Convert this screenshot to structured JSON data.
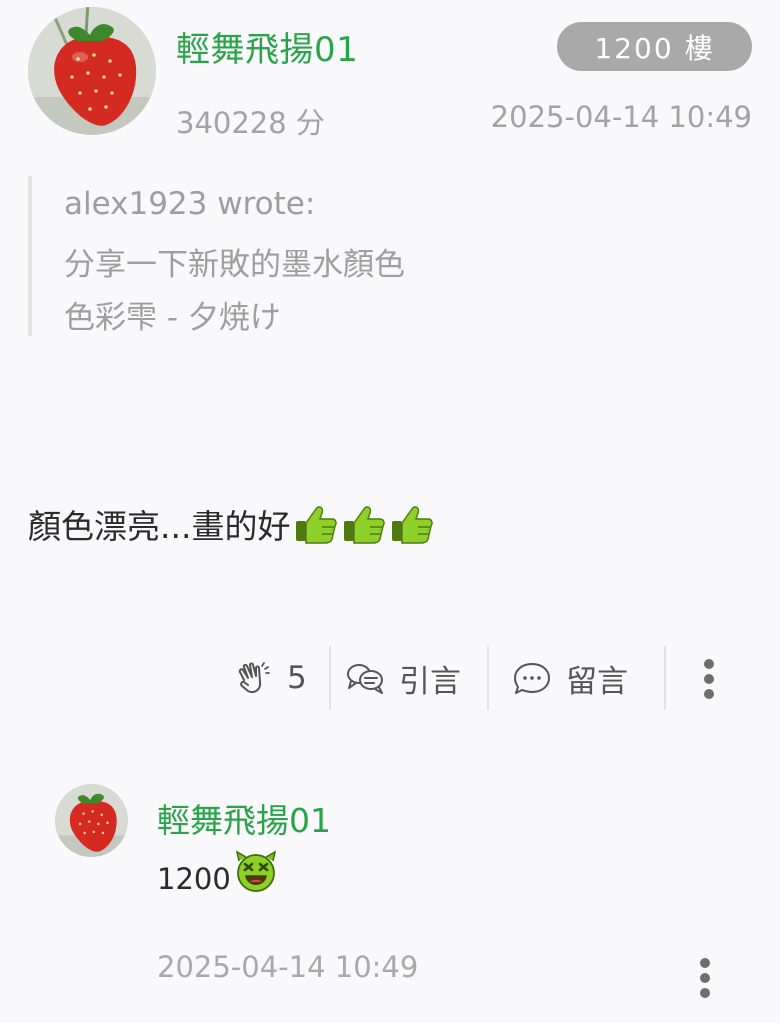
{
  "post": {
    "author": "輕舞飛揚01",
    "floor": "1200 樓",
    "score": "340228 分",
    "timestamp": "2025-04-14 10:49",
    "quote": {
      "header": "alex1923 wrote:",
      "lines": [
        "分享一下新敗的墨水顏色",
        "色彩雫 - 夕焼け"
      ]
    },
    "body": "顏色漂亮...畫的好",
    "body_emoji": [
      "thumbs-up-icon",
      "thumbs-up-icon",
      "thumbs-up-icon"
    ],
    "actions": {
      "likes_count": "5",
      "quote_label": "引言",
      "comment_label": "留言"
    }
  },
  "comment": {
    "author": "輕舞飛揚01",
    "text": "1200",
    "emoji": "laughing-face-icon",
    "timestamp": "2025-04-14 10:49"
  },
  "colors": {
    "username_green": "#2aa44a",
    "badge_gray": "#a9a9a9",
    "meta_gray": "#a3a3a3",
    "background": "#f9f9fb"
  }
}
